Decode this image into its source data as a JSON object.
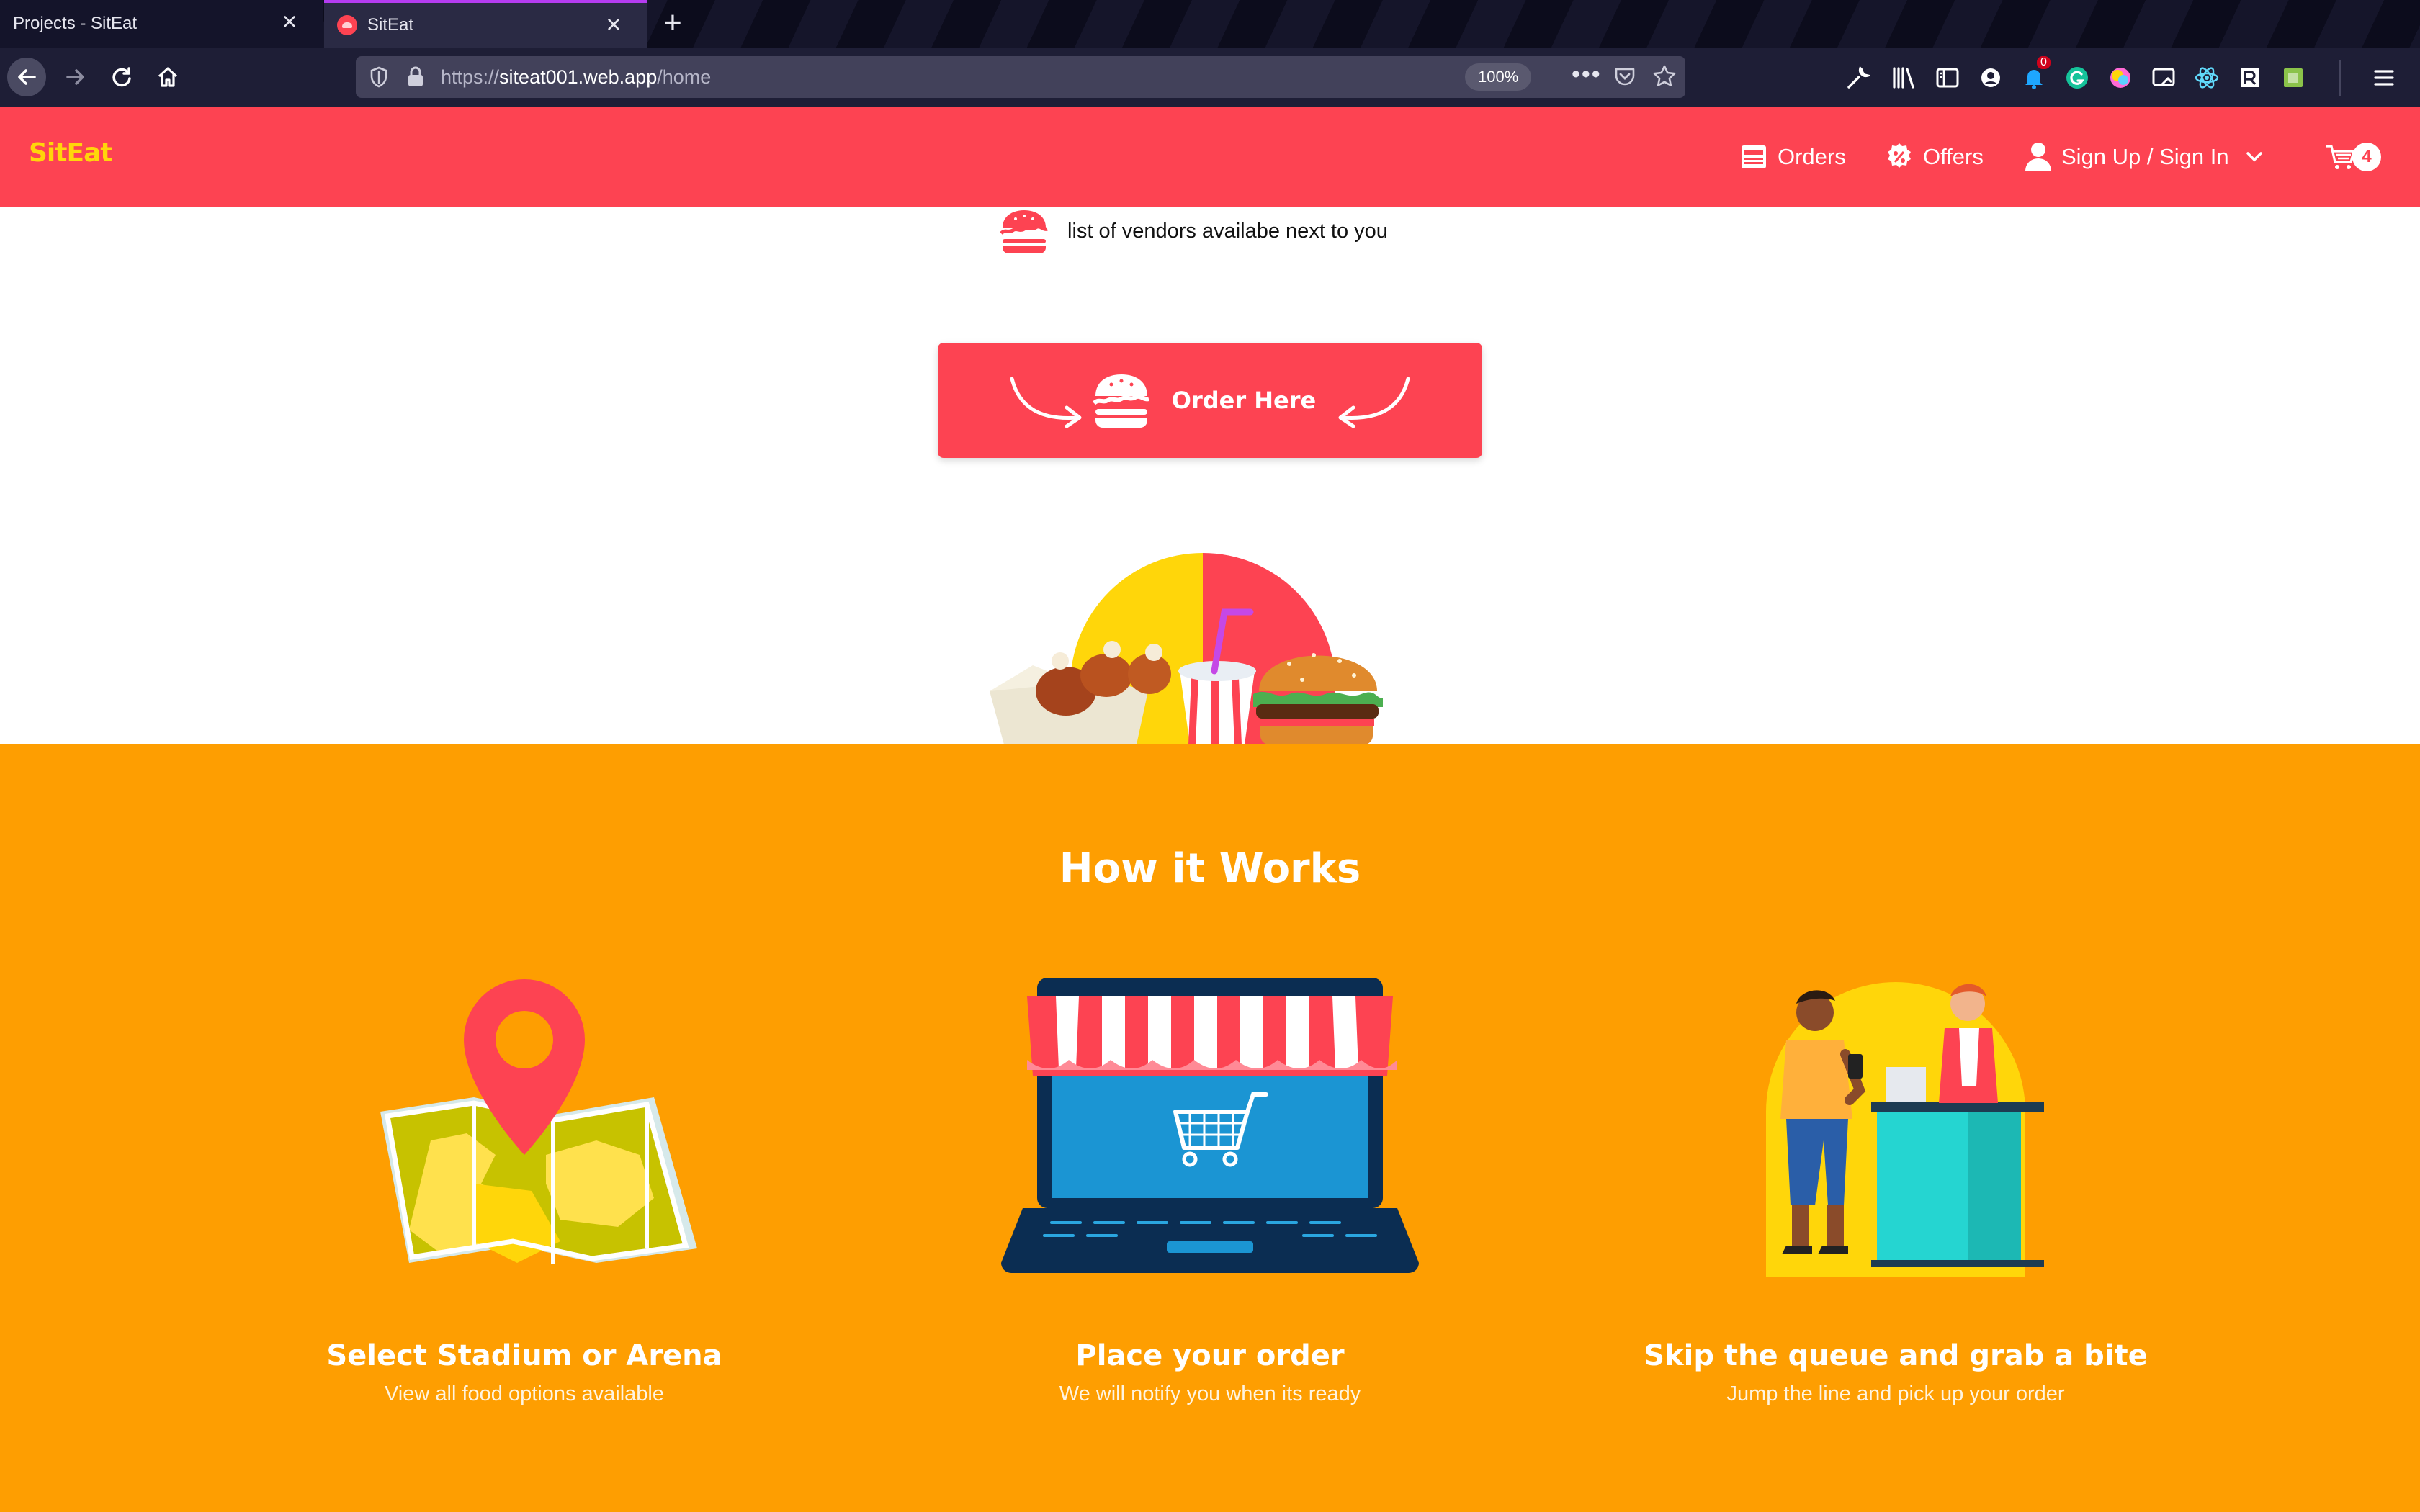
{
  "browser": {
    "tabs": [
      {
        "title": "Projects - SitEat",
        "active": false
      },
      {
        "title": "SitEat",
        "active": true
      }
    ],
    "url": {
      "scheme": "https://",
      "host": "siteat001.web.app",
      "path": "/home"
    },
    "zoom": "100%",
    "extension_badge_count": "0"
  },
  "header": {
    "brand": "SitEat",
    "nav": {
      "orders": "Orders",
      "offers": "Offers",
      "auth": "Sign Up / Sign In"
    },
    "cart_count": "4"
  },
  "hero": {
    "vendors_text": "list of vendors availabe next to you",
    "order_button": "Order Here"
  },
  "how_it_works": {
    "title": "How it Works",
    "steps": [
      {
        "title": "Select Stadium or Arena",
        "subtitle": "View all food options available",
        "icon": "map-pin-illustration"
      },
      {
        "title": "Place your order",
        "subtitle": "We will notify you when its ready",
        "icon": "laptop-shop-illustration"
      },
      {
        "title": "Skip the queue and grab a bite",
        "subtitle": "Jump the line and pick up your order",
        "icon": "counter-pickup-illustration"
      }
    ]
  },
  "colors": {
    "brand_red": "#fd4352",
    "brand_yellow": "#ffd60a",
    "section_orange": "#fe9e01",
    "chrome_dark": "#1e1e36"
  }
}
